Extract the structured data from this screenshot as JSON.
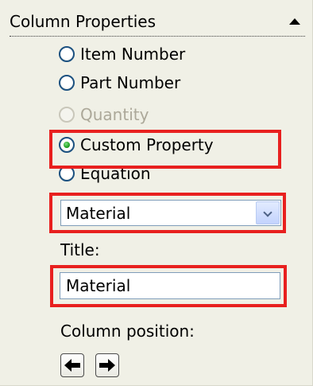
{
  "panel": {
    "title": "Column Properties",
    "collapse_icon": "triangle-up-icon"
  },
  "column_type": {
    "options": [
      {
        "label": "Item Number",
        "selected": false,
        "enabled": true
      },
      {
        "label": "Part Number",
        "selected": false,
        "enabled": true
      },
      {
        "label": "Quantity",
        "selected": false,
        "enabled": false
      },
      {
        "label": "Custom Property",
        "selected": true,
        "enabled": true
      },
      {
        "label": "Equation",
        "selected": false,
        "enabled": true
      }
    ]
  },
  "property_select": {
    "value": "Material"
  },
  "title_field": {
    "label": "Title:",
    "value": "Material"
  },
  "column_position": {
    "label": "Column position:",
    "left_icon": "arrow-left-icon",
    "right_icon": "arrow-right-icon"
  },
  "colors": {
    "panel_background": "#f0f0e6",
    "highlight": "#e8201f",
    "radio_border": "#1c5180",
    "radio_selected": "#21a121",
    "disabled_text": "#aca899"
  }
}
